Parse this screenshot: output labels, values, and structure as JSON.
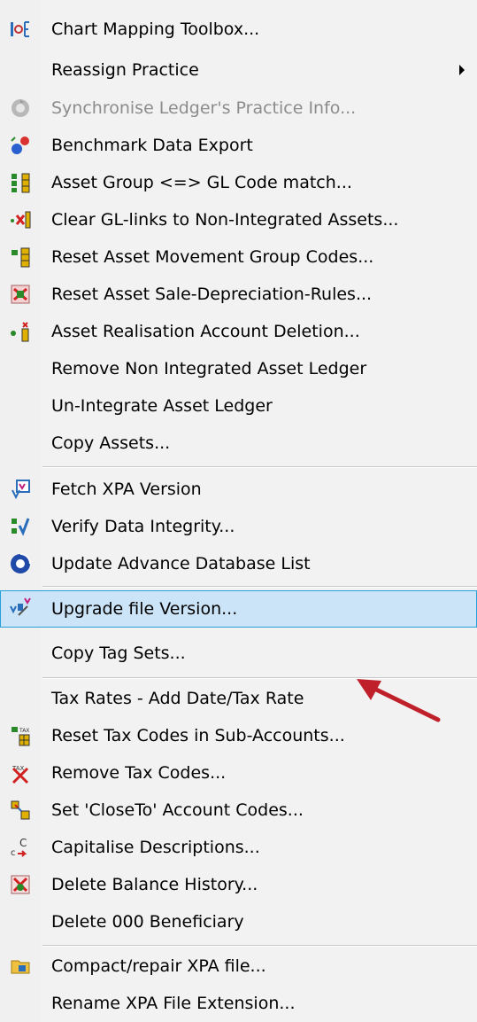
{
  "menu": {
    "items": [
      {
        "label": "Chart Mapping Toolbox...",
        "icon": "chart-mapping-icon"
      },
      {
        "label": "Reassign Practice",
        "submenu": true
      },
      {
        "label": "Synchronise Ledger's Practice Info...",
        "icon": "sync-icon",
        "disabled": true
      },
      {
        "label": "Benchmark Data Export",
        "icon": "benchmark-export-icon"
      },
      {
        "label": "Asset Group <=> GL Code match...",
        "icon": "asset-gl-match-icon"
      },
      {
        "label": "Clear GL-links to Non-Integrated Assets...",
        "icon": "clear-gl-links-icon"
      },
      {
        "label": "Reset Asset Movement Group Codes...",
        "icon": "reset-movement-codes-icon"
      },
      {
        "label": "Reset Asset Sale-Depreciation-Rules...",
        "icon": "reset-sale-rules-icon"
      },
      {
        "label": "Asset Realisation Account Deletion...",
        "icon": "realisation-deletion-icon"
      },
      {
        "label": "Remove Non Integrated Asset Ledger"
      },
      {
        "label": "Un-Integrate Asset Ledger"
      },
      {
        "label": "Copy Assets..."
      },
      {
        "label": "Fetch XPA Version",
        "icon": "fetch-version-icon"
      },
      {
        "label": "Verify Data Integrity...",
        "icon": "verify-integrity-icon"
      },
      {
        "label": "Update Advance Database List",
        "icon": "update-database-icon"
      },
      {
        "label": "Upgrade file Version...",
        "icon": "upgrade-version-icon",
        "highlighted": true
      },
      {
        "label": "Copy Tag Sets..."
      },
      {
        "label": "Tax Rates - Add Date/Tax Rate"
      },
      {
        "label": "Reset Tax Codes in Sub-Accounts...",
        "icon": "reset-tax-codes-icon"
      },
      {
        "label": "Remove Tax Codes...",
        "icon": "remove-tax-codes-icon"
      },
      {
        "label": "Set 'CloseTo' Account Codes...",
        "icon": "set-closeto-icon"
      },
      {
        "label": "Capitalise Descriptions...",
        "icon": "capitalise-icon"
      },
      {
        "label": "Delete Balance History...",
        "icon": "delete-history-icon"
      },
      {
        "label": "Delete 000 Beneficiary"
      },
      {
        "label": "Compact/repair XPA file...",
        "icon": "compact-repair-icon"
      },
      {
        "label": "Rename XPA File Extension..."
      }
    ]
  },
  "colors": {
    "highlight_bg": "#cce4f7",
    "highlight_border": "#26a0da",
    "pointer_arrow": "#c0202a",
    "disabled_text": "#8c8c8c"
  }
}
